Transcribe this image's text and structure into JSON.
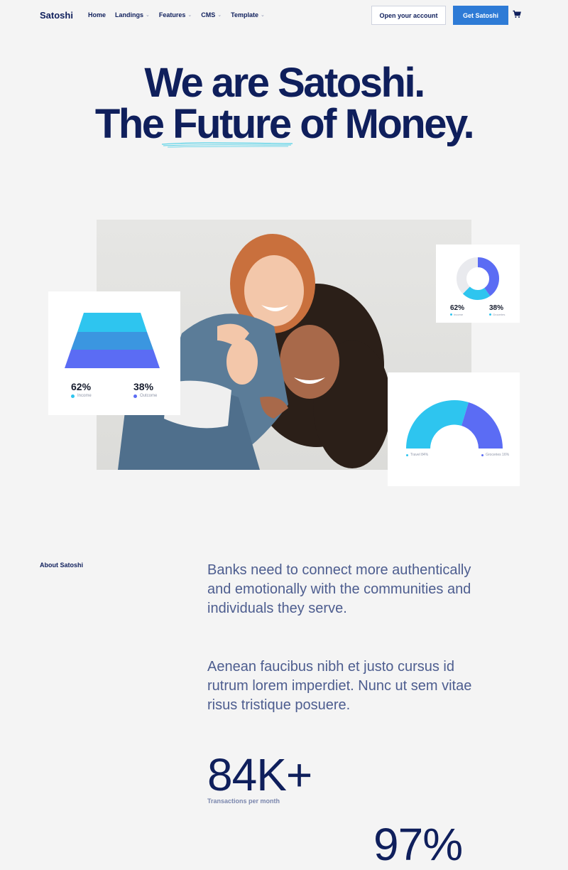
{
  "nav": {
    "logo": "Satoshi",
    "items": [
      {
        "label": "Home",
        "dropdown": false
      },
      {
        "label": "Landings",
        "dropdown": true
      },
      {
        "label": "Features",
        "dropdown": true
      },
      {
        "label": "CMS",
        "dropdown": true
      },
      {
        "label": "Template",
        "dropdown": true
      }
    ],
    "open_account_label": "Open your account",
    "get_label": "Get Satoshi",
    "cart_icon": "cart-icon"
  },
  "hero": {
    "line1": "We are Satoshi.",
    "line2_pre": "The ",
    "line2_underlined": "Future",
    "line2_post": " of Money."
  },
  "cards": {
    "pyramid": {
      "income_pct": "62%",
      "income_label": "Income",
      "outcome_pct": "38%",
      "outcome_label": "Outcome"
    },
    "donut": {
      "left_pct": "62%",
      "left_label": "Income",
      "right_pct": "38%",
      "right_label": "Groceries"
    },
    "gauge": {
      "left_label": "Travel 84%",
      "right_label": "Groceries 16%"
    }
  },
  "about": {
    "label": "About Satoshi",
    "p1": "Banks need to connect more authentically and emotionally with the communities and individuals they serve.",
    "p2": "Aenean faucibus nibh et justo cursus id rutrum lorem imperdiet. Nunc ut sem vitae risus tristique posuere.",
    "stat1_value": "84K+",
    "stat1_label": "Transactions per month",
    "stat2_value": "97%"
  },
  "colors": {
    "navy": "#0f1f5c",
    "primary": "#2e7bd6",
    "cyan": "#2ec5ef",
    "blue": "#3b96e0",
    "violet": "#5b6cf4"
  }
}
